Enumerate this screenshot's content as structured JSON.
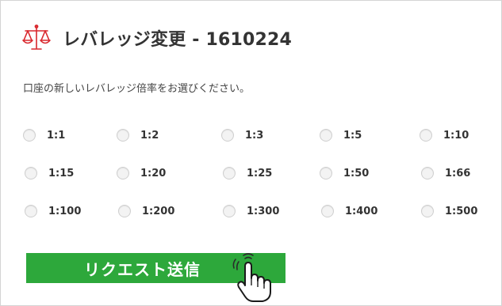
{
  "header": {
    "title": "レバレッジ変更 - 1610224",
    "icon": "scale-icon",
    "icon_color": "#d9262c"
  },
  "instruction": "口座の新しいレバレッジ倍率をお選びください。",
  "leverage_options": [
    "1:1",
    "1:2",
    "1:3",
    "1:5",
    "1:10",
    "1:15",
    "1:20",
    "1:25",
    "1:50",
    "1:66",
    "1:100",
    "1:200",
    "1:300",
    "1:400",
    "1:500"
  ],
  "submit": {
    "label": "リクエスト送信",
    "color": "#2da83b"
  },
  "cursor": {
    "icon": "hand-pointer-icon"
  }
}
